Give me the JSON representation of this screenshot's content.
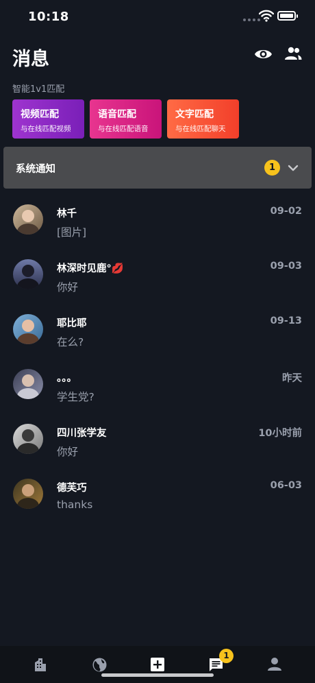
{
  "status_bar": {
    "time": "10:18"
  },
  "header": {
    "title": "消息"
  },
  "match": {
    "label": "智能1v1匹配",
    "cards": [
      {
        "title": "视频匹配",
        "subtitle": "与在线匹配视频",
        "color": "#9e34cf"
      },
      {
        "title": "语音匹配",
        "subtitle": "与在线匹配语音",
        "color": "#e8358f"
      },
      {
        "title": "文字匹配",
        "subtitle": "与在线匹配聊天",
        "color": "#ff6b45"
      }
    ]
  },
  "system_notice": {
    "title": "系统通知",
    "badge": "1"
  },
  "conversations": [
    {
      "name": "林千",
      "message": "[图片]",
      "time": "09-02"
    },
    {
      "name": "林深时见鹿°💋",
      "message": "你好",
      "time": "09-03"
    },
    {
      "name": "耶比耶",
      "message": "在么?",
      "time": "09-13"
    },
    {
      "name": "。。。",
      "message": "学生党?",
      "time": "昨天"
    },
    {
      "name": "四川张学友",
      "message": "你好",
      "time": "10小时前"
    },
    {
      "name": "德芙巧",
      "message": "thanks",
      "time": "06-03"
    }
  ],
  "tabbar": {
    "tabs": [
      "building-icon",
      "globe-icon",
      "plus-icon",
      "chat-icon",
      "person-icon"
    ],
    "active": "chat-icon",
    "chat_badge": "1"
  },
  "colors": {
    "background": "#141821",
    "badge": "#f7c21c",
    "secondary_text": "#9aa0ad"
  }
}
